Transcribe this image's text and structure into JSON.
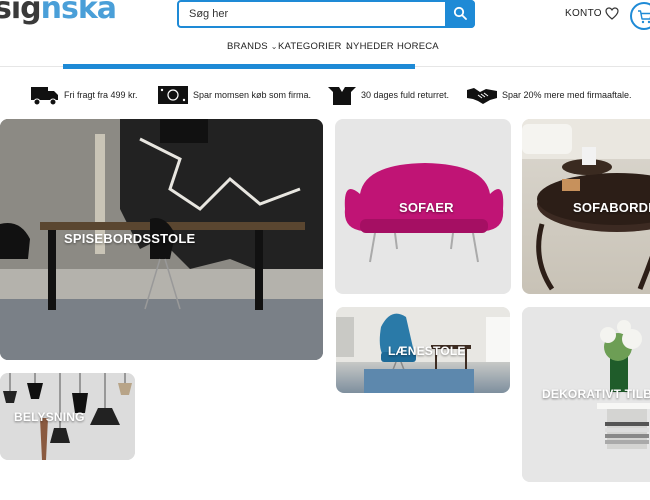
{
  "header": {
    "logo_dark": "sig",
    "logo_light": "nska",
    "search_placeholder": "Søg her",
    "account_label": "KONTO"
  },
  "nav": {
    "items": [
      {
        "label": "BRANDS",
        "has_dropdown": true
      },
      {
        "label": "KATEGORIER",
        "has_dropdown": true
      },
      {
        "label": "NYHEDER",
        "has_dropdown": false
      },
      {
        "label": "HORECA",
        "has_dropdown": false
      }
    ]
  },
  "usps": [
    {
      "icon": "truck-icon",
      "text": "Fri fragt fra 499 kr."
    },
    {
      "icon": "banknote-icon",
      "text": "Spar momsen køb som firma."
    },
    {
      "icon": "open-box-icon",
      "text": "30 dages fuld returret."
    },
    {
      "icon": "handshake-icon",
      "text": "Spar 20% mere med firmaaftale."
    }
  ],
  "categories": [
    {
      "label": "SPISEBORDSSTOLE"
    },
    {
      "label": "SOFAER"
    },
    {
      "label": "SOFABORDE"
    },
    {
      "label": "LÆNESTOLE"
    },
    {
      "label": "DEKORATIVT TILBEHØR"
    },
    {
      "label": "BELYSNING"
    }
  ],
  "colors": {
    "accent": "#1e8ad6",
    "sofa": "#c01475"
  }
}
